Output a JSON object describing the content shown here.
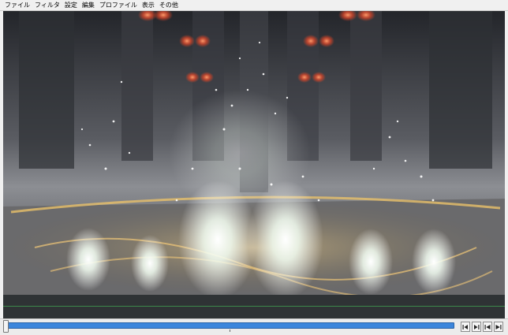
{
  "menubar": {
    "items": [
      "ファイル",
      "フィルタ",
      "設定",
      "編集",
      "プロファイル",
      "表示",
      "その他"
    ]
  },
  "controls": {
    "icons": [
      "prev-frame-icon",
      "next-frame-icon",
      "jump-start-icon",
      "jump-end-icon"
    ]
  },
  "colors": {
    "seek_fill": "#3c86dc",
    "track_bg": "#2f3335",
    "track_line": "#3d8a4a"
  }
}
